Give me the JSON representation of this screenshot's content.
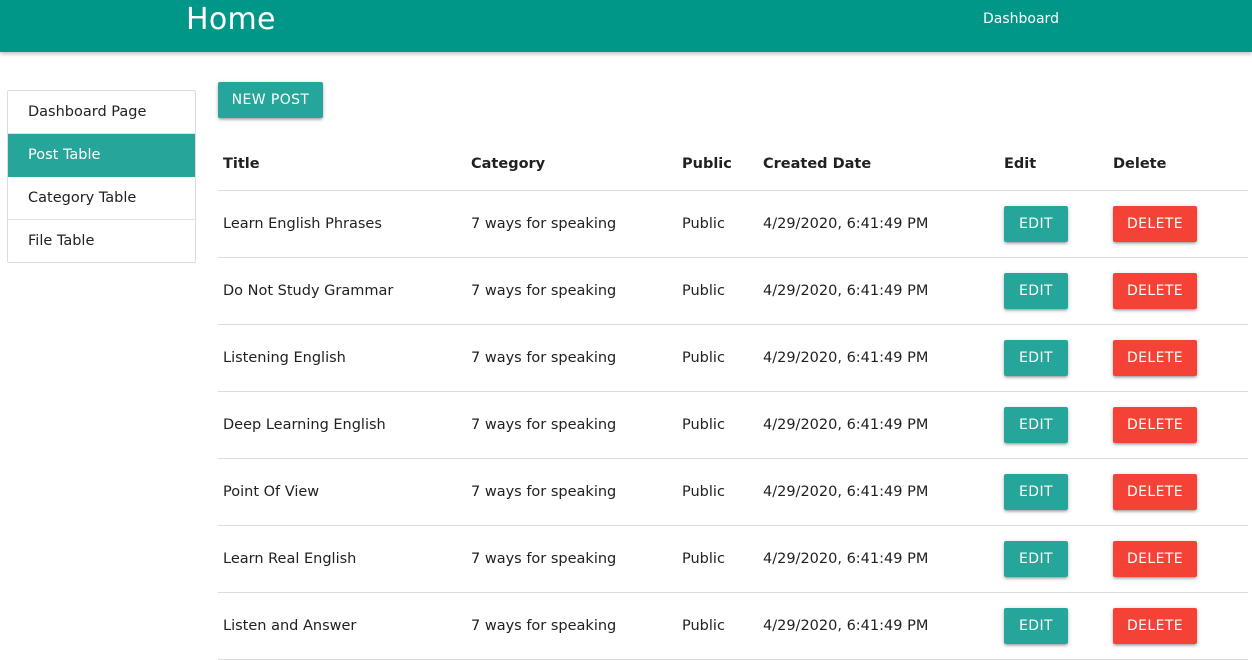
{
  "navbar": {
    "brand": "Home",
    "links": [
      "Dashboard"
    ],
    "color": "#009688"
  },
  "sidebar": {
    "items": [
      {
        "label": "Dashboard Page",
        "active": false
      },
      {
        "label": "Post Table",
        "active": true
      },
      {
        "label": "Category Table",
        "active": false
      },
      {
        "label": "File Table",
        "active": false
      }
    ],
    "active_color": "#26a69a"
  },
  "main": {
    "new_post_label": "NEW POST",
    "table": {
      "columns": [
        "Title",
        "Category",
        "Public",
        "Created Date",
        "Edit",
        "Delete"
      ],
      "edit_label": "EDIT",
      "delete_label": "DELETE",
      "rows": [
        {
          "title": "Learn English Phrases",
          "category": "7 ways for speaking",
          "public": "Public",
          "created": "4/29/2020, 6:41:49 PM"
        },
        {
          "title": "Do Not Study Grammar",
          "category": "7 ways for speaking",
          "public": "Public",
          "created": "4/29/2020, 6:41:49 PM"
        },
        {
          "title": "Listening English",
          "category": "7 ways for speaking",
          "public": "Public",
          "created": "4/29/2020, 6:41:49 PM"
        },
        {
          "title": "Deep Learning English",
          "category": "7 ways for speaking",
          "public": "Public",
          "created": "4/29/2020, 6:41:49 PM"
        },
        {
          "title": "Point Of View",
          "category": "7 ways for speaking",
          "public": "Public",
          "created": "4/29/2020, 6:41:49 PM"
        },
        {
          "title": "Learn Real English",
          "category": "7 ways for speaking",
          "public": "Public",
          "created": "4/29/2020, 6:41:49 PM"
        },
        {
          "title": "Listen and Answer",
          "category": "7 ways for speaking",
          "public": "Public",
          "created": "4/29/2020, 6:41:49 PM"
        }
      ]
    },
    "colors": {
      "edit_button": "#26a69a",
      "delete_button": "#f44336"
    }
  }
}
